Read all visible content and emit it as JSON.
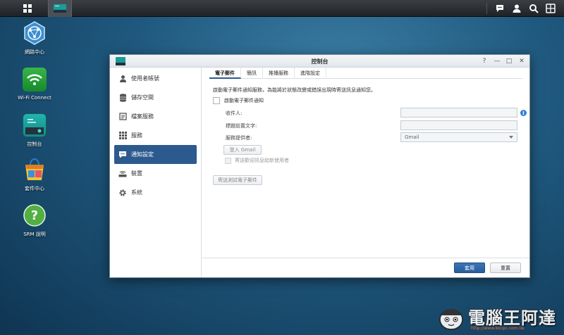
{
  "taskbar": {
    "main_menu_icon": "grid-icon",
    "open_app_icon": "control-panel-icon",
    "right_icons": [
      "chat-icon",
      "user-icon",
      "search-icon",
      "widgets-icon"
    ]
  },
  "desktop": {
    "icons": [
      {
        "label": "網路中心",
        "icon": "network-center-icon"
      },
      {
        "label": "Wi-Fi Connect",
        "icon": "wifi-icon"
      },
      {
        "label": "控制台",
        "icon": "control-panel-icon"
      },
      {
        "label": "套件中心",
        "icon": "package-center-icon"
      },
      {
        "label": "SRM 說明",
        "icon": "help-icon"
      }
    ]
  },
  "window": {
    "title": "控制台",
    "controls": [
      "?",
      "—",
      "□",
      "✕"
    ],
    "sidebar": {
      "items": [
        {
          "label": "使用者帳號",
          "icon": "user-icon"
        },
        {
          "label": "儲存空間",
          "icon": "database-icon"
        },
        {
          "label": "檔案服務",
          "icon": "file-services-icon"
        },
        {
          "label": "服務",
          "icon": "services-grid-icon"
        },
        {
          "label": "通知設定",
          "icon": "notification-icon"
        },
        {
          "label": "裝置",
          "icon": "router-icon"
        },
        {
          "label": "系統",
          "icon": "gear-icon"
        }
      ],
      "active_index": 4
    },
    "tabs": [
      "電子郵件",
      "簡訊",
      "推播服務",
      "進階設定"
    ],
    "active_tab": 0,
    "email": {
      "description": "啟動電子郵件通知服務，為能將於狀態改變或錯誤出現時寄送訊息通知您。",
      "enable_label": "啟動電子郵件通知",
      "enable_checked": false,
      "recipient_label": "收件人:",
      "recipient_value": "",
      "subject_prefix_label": "標題前置文字:",
      "subject_prefix_value": "",
      "provider_label": "服務提供者:",
      "provider_value": "Gmail",
      "login_button": "登入 Gmail",
      "welcome_label": "寄送歡迎訊息給新使用者",
      "send_test_button": "寄送測試電子郵件"
    },
    "footer": {
      "apply_label": "套用",
      "reset_label": "重置"
    }
  },
  "watermark": {
    "brand": "電腦王阿達",
    "url": "http://www.kocpc.com.tw"
  },
  "colors": {
    "accent": "#2d5a8e",
    "info": "#2f7ed8"
  }
}
